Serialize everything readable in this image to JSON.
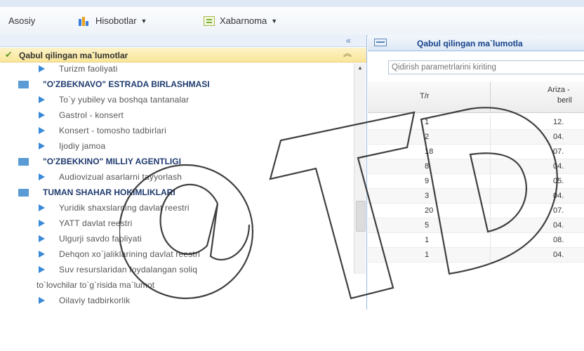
{
  "menu": {
    "home": "Asosiy",
    "reports": "Hisobotlar",
    "bulletin": "Xabarnoma"
  },
  "accordion": {
    "title": "Qabul qilingan ma`lumotlar"
  },
  "tree": [
    {
      "kind": "leaf",
      "label": "Turizm faoliyati"
    },
    {
      "kind": "group",
      "label": "\"O'ZBEKNAVO\" ESTRADA BIRLASHMASI"
    },
    {
      "kind": "leaf",
      "label": "To`y yubiley va boshqa tantanalar"
    },
    {
      "kind": "leaf",
      "label": "Gastrol - konsert"
    },
    {
      "kind": "leaf",
      "label": "Konsert - tomosho tadbirlari"
    },
    {
      "kind": "leaf",
      "label": "Ijodiy jamoa"
    },
    {
      "kind": "group",
      "label": "\"O'ZBEKKINO\" MILLIY AGENTLIGI"
    },
    {
      "kind": "leaf",
      "label": "Audiovizual asarlarni tayyorlash"
    },
    {
      "kind": "group",
      "label": "TUMAN SHAHAR HOKIMLIKLARI"
    },
    {
      "kind": "leaf",
      "label": "Yuridik shaxslarning davlat reestri"
    },
    {
      "kind": "leaf",
      "label": "YATT davlat reestri"
    },
    {
      "kind": "leaf",
      "label": "Ulgurji savdo faoliyati"
    },
    {
      "kind": "leaf",
      "label": "Dehqon xo`jaliklarining davlat reestri"
    },
    {
      "kind": "leaf",
      "label": "Suv resurslaridan foydalangan soliq"
    },
    {
      "kind": "cont",
      "label": "to`lovchilar to`g`risida ma`lumot"
    },
    {
      "kind": "leaf",
      "label": "Oilaviy tadbirkorlik"
    }
  ],
  "right": {
    "title": "Qabul qilingan ma`lumotla",
    "search_placeholder": "Qidirish parametrlarini kiriting",
    "col_tr": "T/r",
    "col_ariza_1": "Ariza -",
    "col_ariza_2": "beril",
    "rows": [
      {
        "n": "1",
        "d": "12."
      },
      {
        "n": "2",
        "d": "04."
      },
      {
        "n": "18",
        "d": "07."
      },
      {
        "n": "8",
        "d": "04."
      },
      {
        "n": "9",
        "d": "05."
      },
      {
        "n": "3",
        "d": "04."
      },
      {
        "n": "20",
        "d": "07."
      },
      {
        "n": "5",
        "d": "04."
      },
      {
        "n": "1",
        "d": "08."
      },
      {
        "n": "1",
        "d": "04."
      }
    ]
  },
  "colors": {
    "accent": "#15428b",
    "group_folder": "#5b9bd5",
    "leaf_arrow": "#3b8ad9",
    "accordion_bg": "#f9e69a"
  }
}
